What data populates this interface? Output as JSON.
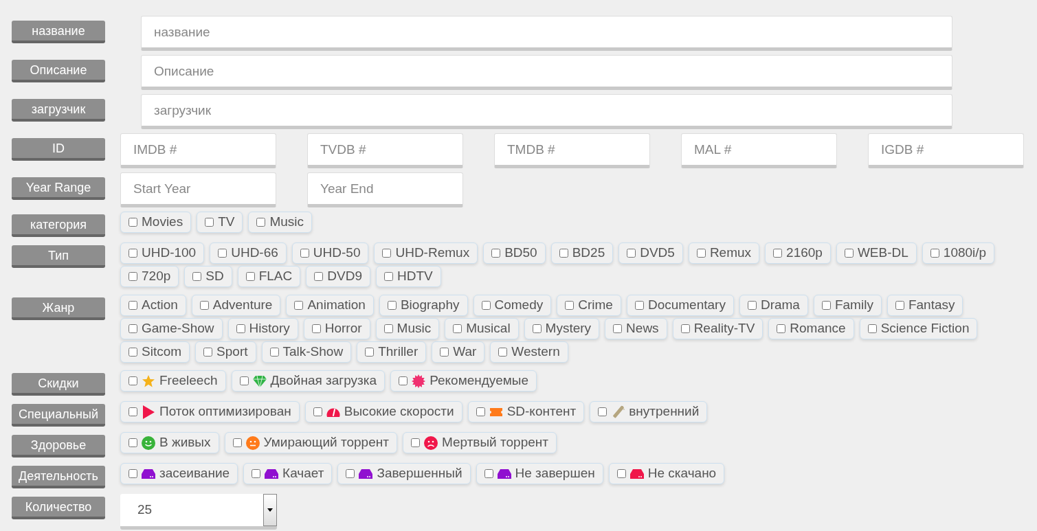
{
  "rows": [
    {
      "kind": "text",
      "label": "название",
      "placeholder": "название"
    },
    {
      "kind": "text",
      "label": "Описание",
      "placeholder": "Описание"
    },
    {
      "kind": "text",
      "label": "загрузчик",
      "placeholder": "загрузчик"
    },
    {
      "kind": "inputs",
      "label": "ID",
      "inputs": [
        {
          "placeholder": "IMDB #"
        },
        {
          "placeholder": "TVDB #"
        },
        {
          "placeholder": "TMDB #"
        },
        {
          "placeholder": "MAL #"
        },
        {
          "placeholder": "IGDB #"
        }
      ]
    },
    {
      "kind": "inputs",
      "label": "Year Range",
      "inputs": [
        {
          "placeholder": "Start Year"
        },
        {
          "placeholder": "Year End"
        }
      ]
    },
    {
      "kind": "checks",
      "label": "категория",
      "options": [
        {
          "text": "Movies",
          "checked": false
        },
        {
          "text": "TV",
          "checked": false
        },
        {
          "text": "Music",
          "checked": false
        }
      ]
    },
    {
      "kind": "checks",
      "label": "Тип",
      "options": [
        {
          "text": "UHD-100",
          "checked": false
        },
        {
          "text": "UHD-66",
          "checked": false
        },
        {
          "text": "UHD-50",
          "checked": false
        },
        {
          "text": "UHD-Remux",
          "checked": false
        },
        {
          "text": "BD50",
          "checked": false
        },
        {
          "text": "BD25",
          "checked": false
        },
        {
          "text": "DVD5",
          "checked": false
        },
        {
          "text": "Remux",
          "checked": false
        },
        {
          "text": "2160p",
          "checked": false
        },
        {
          "text": "WEB-DL",
          "checked": false
        },
        {
          "text": "1080i/p",
          "checked": false
        },
        {
          "text": "720p",
          "checked": false
        },
        {
          "text": "SD",
          "checked": false
        },
        {
          "text": "FLAC",
          "checked": false
        },
        {
          "text": "DVD9",
          "checked": false
        },
        {
          "text": "HDTV",
          "checked": false
        }
      ]
    },
    {
      "kind": "checks",
      "label": "Жанр",
      "options": [
        {
          "text": "Action",
          "checked": false
        },
        {
          "text": "Adventure",
          "checked": false
        },
        {
          "text": "Animation",
          "checked": false
        },
        {
          "text": "Biography",
          "checked": false
        },
        {
          "text": "Comedy",
          "checked": false
        },
        {
          "text": "Crime",
          "checked": false
        },
        {
          "text": "Documentary",
          "checked": false
        },
        {
          "text": "Drama",
          "checked": false
        },
        {
          "text": "Family",
          "checked": false
        },
        {
          "text": "Fantasy",
          "checked": false
        },
        {
          "text": "Game-Show",
          "checked": false
        },
        {
          "text": "History",
          "checked": false
        },
        {
          "text": "Horror",
          "checked": false
        },
        {
          "text": "Music",
          "checked": false
        },
        {
          "text": "Musical",
          "checked": false
        },
        {
          "text": "Mystery",
          "checked": false
        },
        {
          "text": "News",
          "checked": false
        },
        {
          "text": "Reality-TV",
          "checked": false
        },
        {
          "text": "Romance",
          "checked": false
        },
        {
          "text": "Science Fiction",
          "checked": false
        },
        {
          "text": "Sitcom",
          "checked": false
        },
        {
          "text": "Sport",
          "checked": false
        },
        {
          "text": "Talk-Show",
          "checked": false
        },
        {
          "text": "Thriller",
          "checked": false
        },
        {
          "text": "War",
          "checked": false
        },
        {
          "text": "Western",
          "checked": false
        }
      ]
    },
    {
      "kind": "checks",
      "label": "Скидки",
      "options": [
        {
          "text": "Freeleech",
          "checked": false,
          "kind": "star"
        },
        {
          "text": "Двойная загрузка",
          "checked": false,
          "kind": "gem"
        },
        {
          "text": "Рекомендуемые",
          "checked": false,
          "kind": "burst"
        }
      ]
    },
    {
      "kind": "checks",
      "label": "Специальный",
      "options": [
        {
          "text": "Поток оптимизирован",
          "checked": false,
          "kind": "play"
        },
        {
          "text": "Высокие скорости",
          "checked": false,
          "kind": "gauge"
        },
        {
          "text": "SD-контент",
          "checked": false,
          "kind": "ticket"
        },
        {
          "text": "внутренний",
          "checked": false,
          "kind": "wand"
        }
      ]
    },
    {
      "kind": "checks",
      "label": "Здоровье",
      "options": [
        {
          "text": "В живых",
          "checked": false,
          "kind": "smile"
        },
        {
          "text": "Умирающий торрент",
          "checked": false,
          "kind": "neutral"
        },
        {
          "text": "Мертвый торрент",
          "checked": false,
          "kind": "sad"
        }
      ]
    },
    {
      "kind": "checks",
      "label": "Деятельность",
      "options": [
        {
          "text": "засеивание",
          "checked": false,
          "kind": "drive",
          "color": "#9010d0"
        },
        {
          "text": "Качает",
          "checked": false,
          "kind": "drive",
          "color": "#9010d0"
        },
        {
          "text": "Завершенный",
          "checked": false,
          "kind": "drive",
          "color": "#9010d0"
        },
        {
          "text": "Не завершен",
          "checked": false,
          "kind": "drive",
          "color": "#9010d0"
        },
        {
          "text": "Не скачано",
          "checked": false,
          "kind": "drive",
          "color": "#f0174a"
        }
      ]
    },
    {
      "kind": "select",
      "label": "Количество",
      "value": "25"
    }
  ]
}
